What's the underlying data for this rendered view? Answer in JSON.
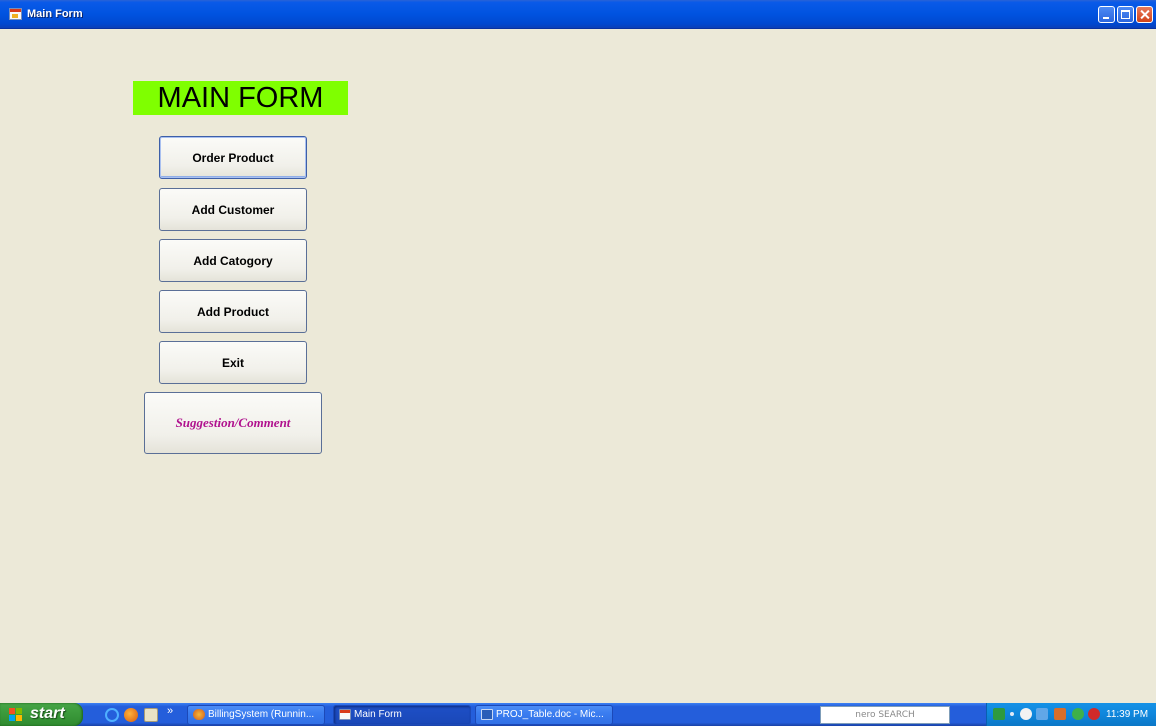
{
  "window": {
    "title": "Main Form",
    "minimize_glyph": "",
    "maximize_glyph": "",
    "close_glyph": ""
  },
  "form": {
    "heading": "MAIN FORM",
    "heading_bg": "#7fff00",
    "buttons": [
      {
        "label": "Order Product"
      },
      {
        "label": "Add Customer"
      },
      {
        "label": "Add Catogory"
      },
      {
        "label": "Add Product"
      },
      {
        "label": "Exit"
      },
      {
        "label": "Suggestion/Comment",
        "color": "#b0128e"
      }
    ]
  },
  "taskbar": {
    "start_label": "start",
    "quicklaunch_more": "»",
    "tasks": [
      {
        "label": "BillingSystem (Runnin...",
        "icon": "billing-app-icon"
      },
      {
        "label": "Main Form",
        "icon": "form-window-icon",
        "active": true
      },
      {
        "label": "PROJ_Table.doc - Mic...",
        "icon": "word-doc-icon"
      }
    ],
    "search_box_text": "nero SEARCH",
    "clock": "11:39 PM"
  }
}
